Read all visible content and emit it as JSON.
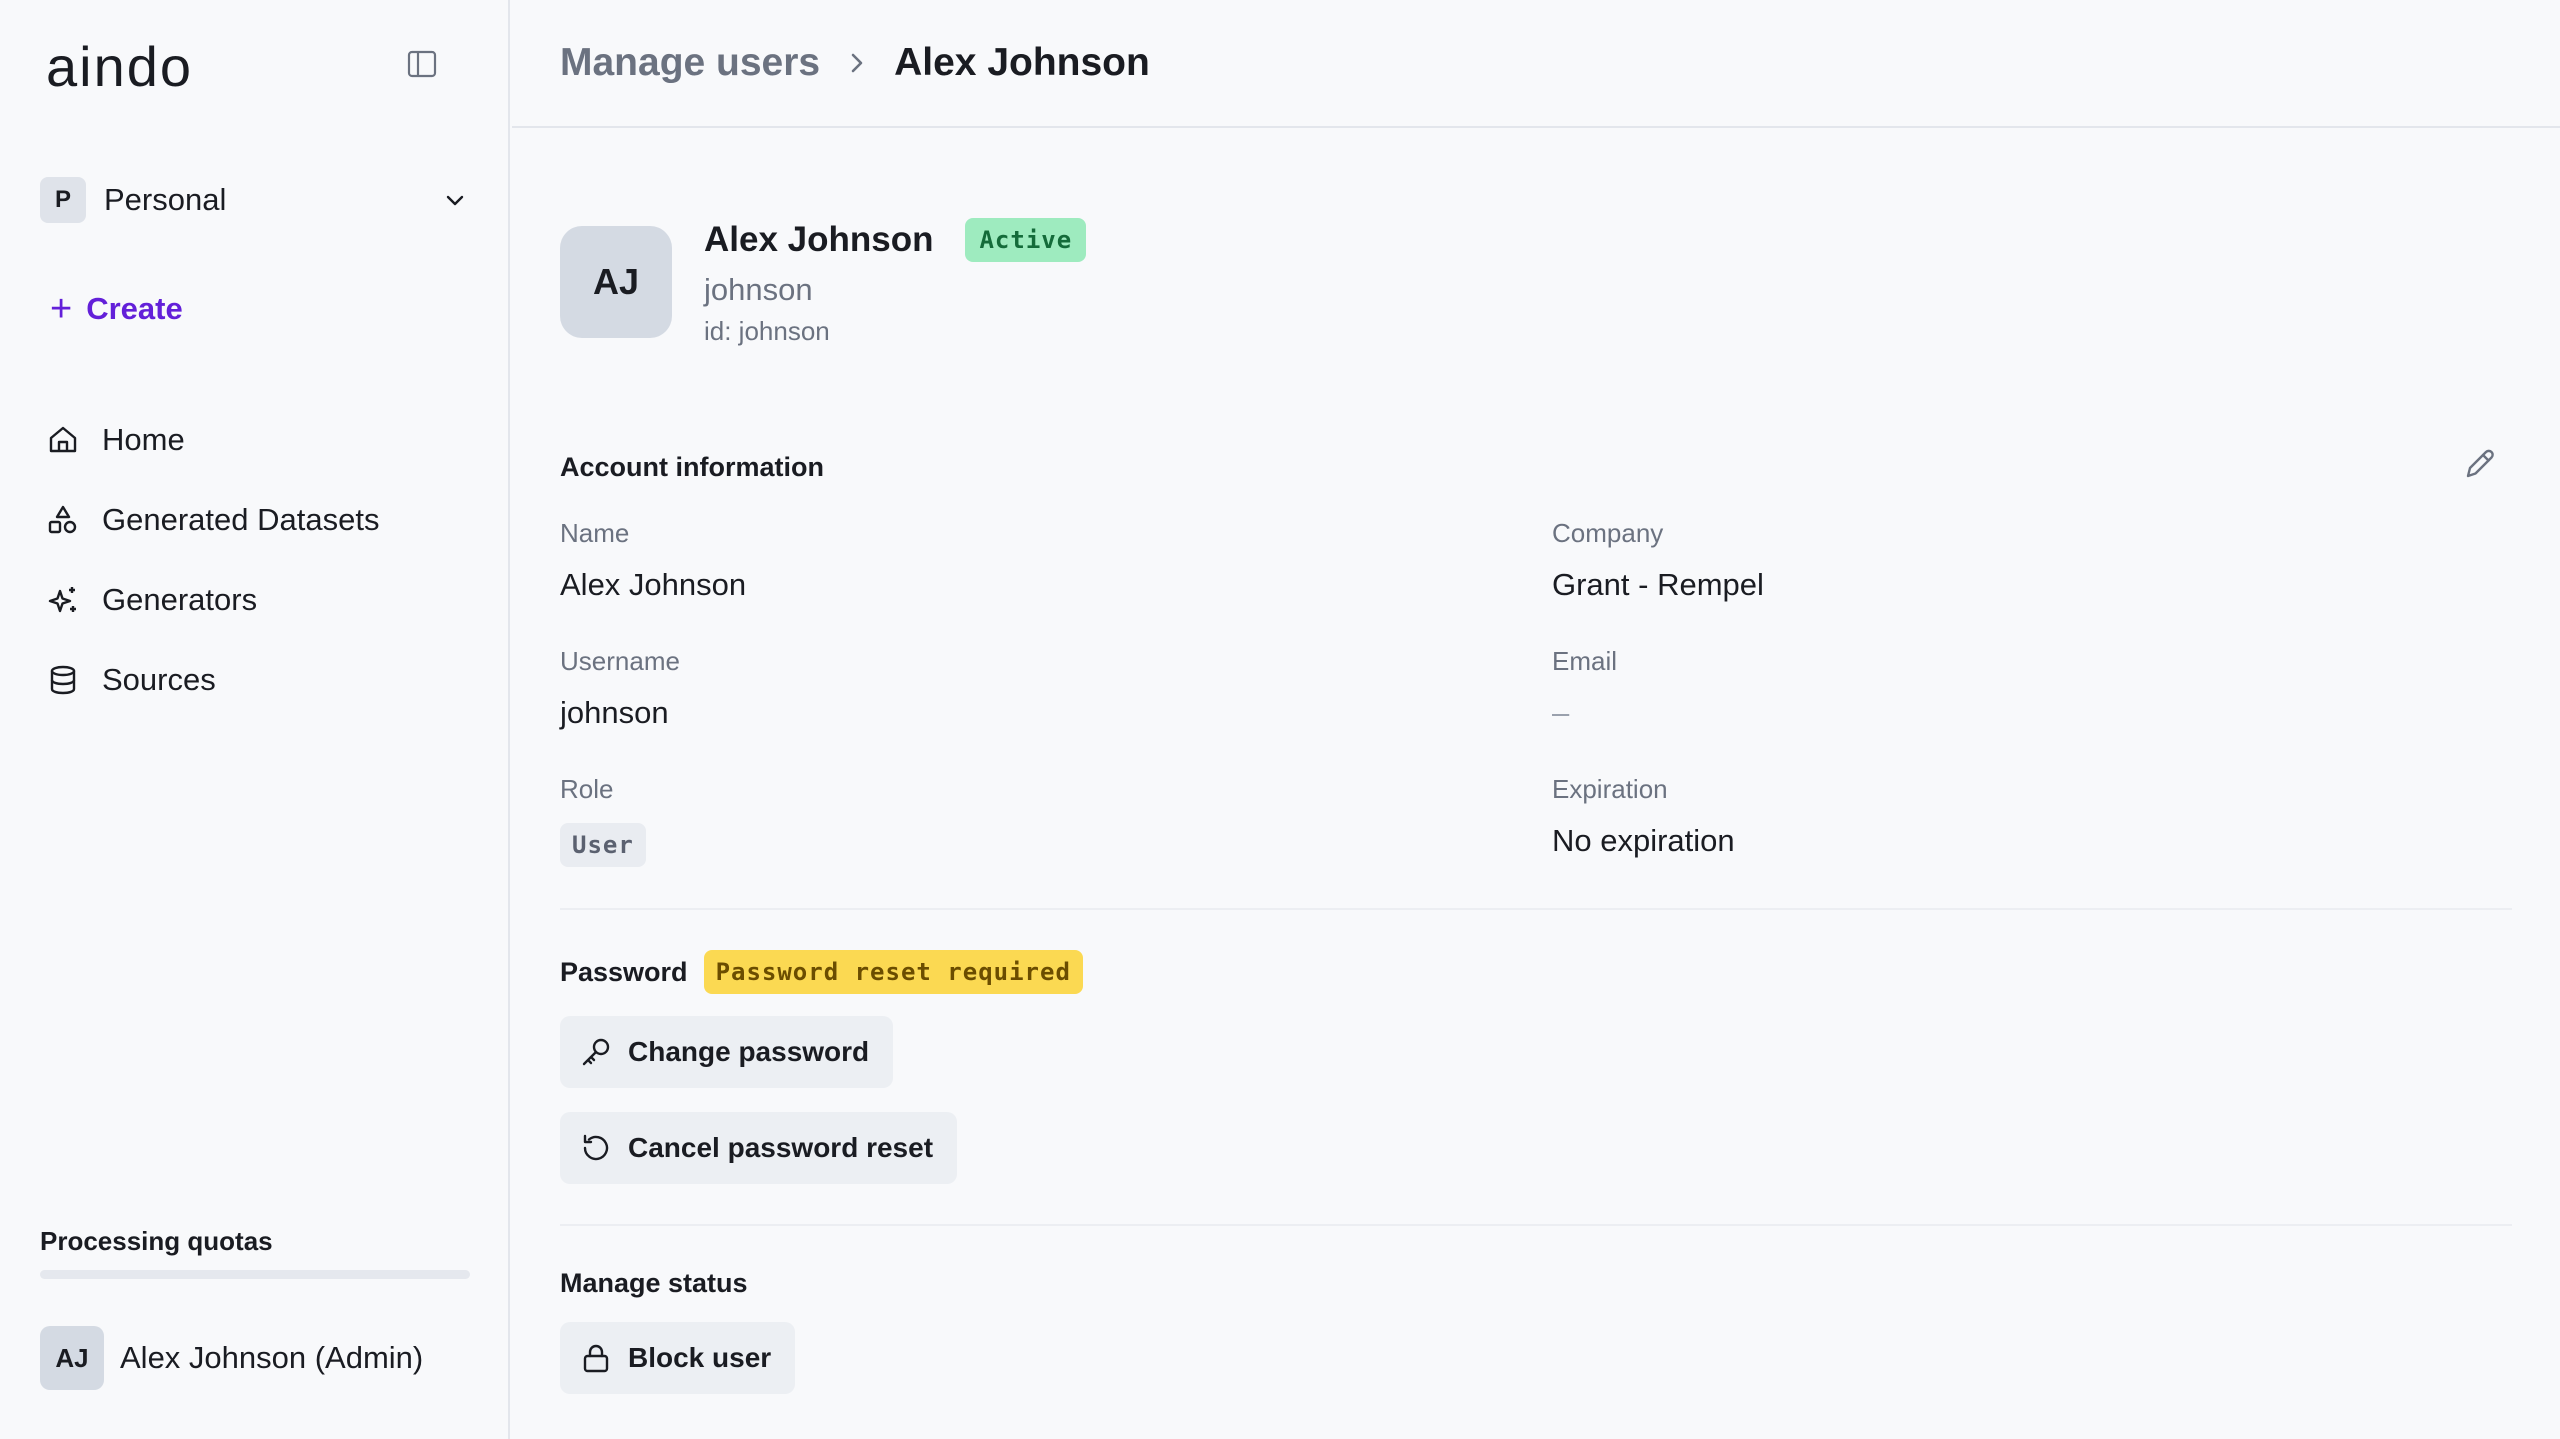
{
  "app": {
    "logo": "aindo"
  },
  "sidebar": {
    "workspace": {
      "initial": "P",
      "name": "Personal"
    },
    "create_label": "Create",
    "items": [
      {
        "label": "Home",
        "icon": "home-icon"
      },
      {
        "label": "Generated Datasets",
        "icon": "shapes-icon"
      },
      {
        "label": "Generators",
        "icon": "sparkles-icon"
      },
      {
        "label": "Sources",
        "icon": "database-icon"
      }
    ],
    "quota": {
      "title": "Processing quotas",
      "fraction": 0.0
    },
    "profile": {
      "initials": "AJ",
      "name": "Alex Johnson (Admin)"
    }
  },
  "header": {
    "breadcrumb_parent": "Manage users",
    "breadcrumb_current": "Alex Johnson"
  },
  "user": {
    "initials": "AJ",
    "name": "Alex Johnson",
    "status": "Active",
    "username": "johnson",
    "id_text": "id: johnson"
  },
  "account": {
    "title": "Account information",
    "name_label": "Name",
    "name_value": "Alex Johnson",
    "company_label": "Company",
    "company_value": "Grant - Rempel",
    "username_label": "Username",
    "username_value": "johnson",
    "email_label": "Email",
    "email_value": "–",
    "role_label": "Role",
    "role_value": "User",
    "expiration_label": "Expiration",
    "expiration_value": "No expiration"
  },
  "password": {
    "title": "Password",
    "badge": "Password reset required",
    "change_label": "Change password",
    "cancel_label": "Cancel password reset"
  },
  "manage_status": {
    "title": "Manage status",
    "block_label": "Block user"
  },
  "colors": {
    "accent": "#6320d9",
    "active_badge_bg": "#9eebbf",
    "active_badge_text": "#146b3a",
    "warning_badge_bg": "#fbd952"
  }
}
